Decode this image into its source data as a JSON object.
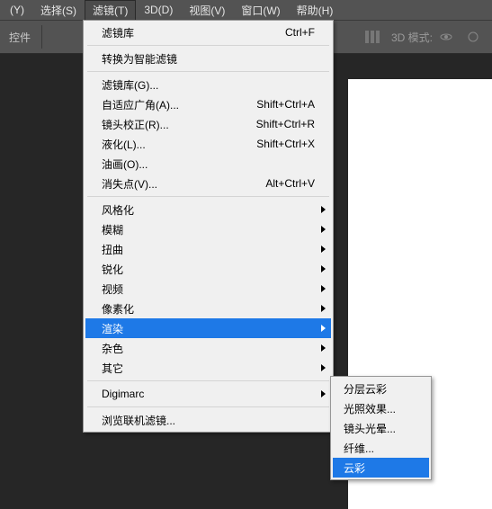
{
  "menubar": {
    "items": [
      {
        "label": "(Y)"
      },
      {
        "label": "选择(S)"
      },
      {
        "label": "滤镜(T)"
      },
      {
        "label": "3D(D)"
      },
      {
        "label": "视图(V)"
      },
      {
        "label": "窗口(W)"
      },
      {
        "label": "帮助(H)"
      }
    ],
    "active_index": 2
  },
  "toolbar": {
    "left_label": "控件",
    "mode_label": "3D 模式:"
  },
  "dropdown": {
    "sections": [
      [
        {
          "label": "滤镜库",
          "shortcut": "Ctrl+F"
        }
      ],
      [
        {
          "label": "转换为智能滤镜"
        }
      ],
      [
        {
          "label": "滤镜库(G)..."
        },
        {
          "label": "自适应广角(A)...",
          "shortcut": "Shift+Ctrl+A"
        },
        {
          "label": "镜头校正(R)...",
          "shortcut": "Shift+Ctrl+R"
        },
        {
          "label": "液化(L)...",
          "shortcut": "Shift+Ctrl+X"
        },
        {
          "label": "油画(O)..."
        },
        {
          "label": "消失点(V)...",
          "shortcut": "Alt+Ctrl+V"
        }
      ],
      [
        {
          "label": "风格化",
          "submenu": true
        },
        {
          "label": "模糊",
          "submenu": true
        },
        {
          "label": "扭曲",
          "submenu": true
        },
        {
          "label": "锐化",
          "submenu": true
        },
        {
          "label": "视频",
          "submenu": true
        },
        {
          "label": "像素化",
          "submenu": true
        },
        {
          "label": "渲染",
          "submenu": true,
          "highlight": true
        },
        {
          "label": "杂色",
          "submenu": true
        },
        {
          "label": "其它",
          "submenu": true
        }
      ],
      [
        {
          "label": "Digimarc",
          "submenu": true
        }
      ],
      [
        {
          "label": "浏览联机滤镜..."
        }
      ]
    ]
  },
  "submenu": {
    "items": [
      {
        "label": "分层云彩"
      },
      {
        "label": "光照效果..."
      },
      {
        "label": "镜头光晕..."
      },
      {
        "label": "纤维..."
      },
      {
        "label": "云彩",
        "highlight": true
      }
    ]
  }
}
